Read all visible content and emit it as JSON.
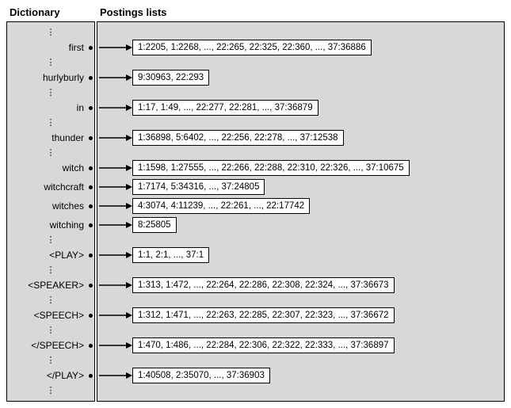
{
  "headers": {
    "dictionary": "Dictionary",
    "postings": "Postings lists"
  },
  "vdots": "⋮",
  "rows": [
    {
      "type": "dots"
    },
    {
      "type": "term",
      "term": "first",
      "posting": "1:2205, 1:2268, ..., 22:265, 22:325, 22:360, ..., 37:36886"
    },
    {
      "type": "dots"
    },
    {
      "type": "term",
      "term": "hurlyburly",
      "posting": "9:30963, 22:293"
    },
    {
      "type": "dots"
    },
    {
      "type": "term",
      "term": "in",
      "posting": "1:17, 1:49, ..., 22:277, 22:281, ..., 37:36879"
    },
    {
      "type": "dots"
    },
    {
      "type": "term",
      "term": "thunder",
      "posting": "1:36898, 5:6402, ..., 22:256, 22:278, ..., 37:12538"
    },
    {
      "type": "dots"
    },
    {
      "type": "term",
      "term": "witch",
      "posting": "1:1598, 1:27555, ..., 22:266, 22:288, 22:310, 22:326, ..., 37:10675"
    },
    {
      "type": "term",
      "term": "witchcraft",
      "posting": "1:7174, 5:34316, ..., 37:24805"
    },
    {
      "type": "term",
      "term": "witches",
      "posting": "4:3074, 4:11239, ..., 22:261, ..., 22:17742"
    },
    {
      "type": "term",
      "term": "witching",
      "posting": "8:25805"
    },
    {
      "type": "dots"
    },
    {
      "type": "term",
      "term": "<PLAY>",
      "posting": "1:1, 2:1, ..., 37:1"
    },
    {
      "type": "dots"
    },
    {
      "type": "term",
      "term": "<SPEAKER>",
      "posting": "1:313, 1:472, ..., 22:264, 22:286, 22:308, 22:324, ..., 37:36673"
    },
    {
      "type": "dots"
    },
    {
      "type": "term",
      "term": "<SPEECH>",
      "posting": "1:312, 1:471, ..., 22:263, 22:285, 22:307, 22:323, ..., 37:36672"
    },
    {
      "type": "dots"
    },
    {
      "type": "term",
      "term": "</SPEECH>",
      "posting": "1:470, 1:486, ..., 22:284, 22:306, 22:322, 22:333, ..., 37:36897"
    },
    {
      "type": "dots"
    },
    {
      "type": "term",
      "term": "</PLAY>",
      "posting": "1:40508, 2:35070, ..., 37:36903"
    },
    {
      "type": "dots"
    }
  ]
}
